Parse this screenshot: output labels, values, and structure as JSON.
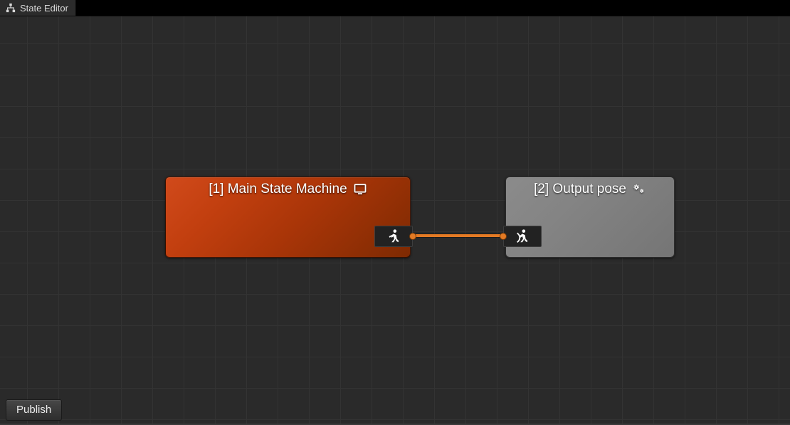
{
  "tab": {
    "label": "State Editor"
  },
  "nodes": {
    "n1": {
      "title": "[1] Main State Machine"
    },
    "n2": {
      "title": "[2] Output pose"
    }
  },
  "buttons": {
    "publish": "Publish"
  },
  "colors": {
    "edge": "#e37a24",
    "node1_gradient_start": "#d14a1b",
    "node1_gradient_end": "#7e2a02",
    "node2_gradient_start": "#8b8b8b",
    "node2_gradient_end": "#757575",
    "canvas_bg": "#2a2a2a",
    "grid_line": "#333333"
  }
}
